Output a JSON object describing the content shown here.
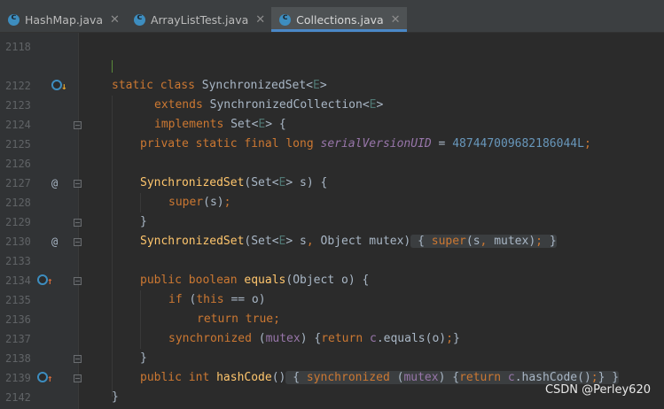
{
  "tabs": [
    {
      "label": "HashMap.java",
      "active": false,
      "icon": "java-class-icon"
    },
    {
      "label": "ArrayListTest.java",
      "active": false,
      "icon": "java-class-icon"
    },
    {
      "label": "Collections.java",
      "active": true,
      "icon": "java-class-icon"
    }
  ],
  "close_glyph": "✕",
  "gutter": {
    "lines": [
      "2118",
      "",
      "2122",
      "2123",
      "2124",
      "2125",
      "2126",
      "2127",
      "2128",
      "2129",
      "2130",
      "2133",
      "2134",
      "2135",
      "2136",
      "2137",
      "2138",
      "2139",
      "2142"
    ],
    "annotations": {
      "2122": "implementations-icon",
      "2127": "at-icon",
      "2130": "at-icon",
      "2134": "overrides-icon",
      "2139": "overrides-icon"
    },
    "at_glyph": "@"
  },
  "code": {
    "l2122": [
      "static class ",
      "SynchronizedSet",
      "<",
      "E",
      ">"
    ],
    "l2123": [
      "extends ",
      "SynchronizedCollection",
      "<",
      "E",
      ">"
    ],
    "l2124": [
      "implements ",
      "Set",
      "<",
      "E",
      "> {"
    ],
    "l2125": [
      "private static final long ",
      "serialVersionUID",
      " = ",
      "487447009682186044L",
      ";"
    ],
    "l2127": [
      "SynchronizedSet",
      "(Set<",
      "E",
      "> s) {"
    ],
    "l2128": [
      "super",
      "(s)",
      ";"
    ],
    "l2129": [
      "}"
    ],
    "l2130": [
      "SynchronizedSet",
      "(Set<",
      "E",
      "> s",
      ", ",
      "Object mutex)",
      " { ",
      "super",
      "(s",
      ", ",
      "mutex)",
      ";",
      " }"
    ],
    "l2134": [
      "public boolean ",
      "equals",
      "(Object o) {"
    ],
    "l2135": [
      "if ",
      "(",
      "this ",
      "== o)"
    ],
    "l2136": [
      "return true",
      ";"
    ],
    "l2137": [
      "synchronized ",
      "(",
      "mutex",
      ") {",
      "return ",
      "c",
      ".equals(o)",
      ";",
      "}"
    ],
    "l2138": [
      "}"
    ],
    "l2139": [
      "public int ",
      "hashCode",
      "()",
      " { ",
      "synchronized ",
      "(",
      "mutex",
      ") {",
      "return ",
      "c",
      ".hashCode()",
      ";",
      "}",
      " }"
    ],
    "l2142": [
      "}"
    ]
  },
  "watermark": "CSDN @Perley620",
  "colors": {
    "background": "#2b2b2b",
    "keyword": "#cc7832",
    "method": "#ffc66d",
    "field": "#9876aa",
    "number": "#6897bb",
    "type_param": "#507874",
    "active_tab_underline": "#4a88c7"
  }
}
